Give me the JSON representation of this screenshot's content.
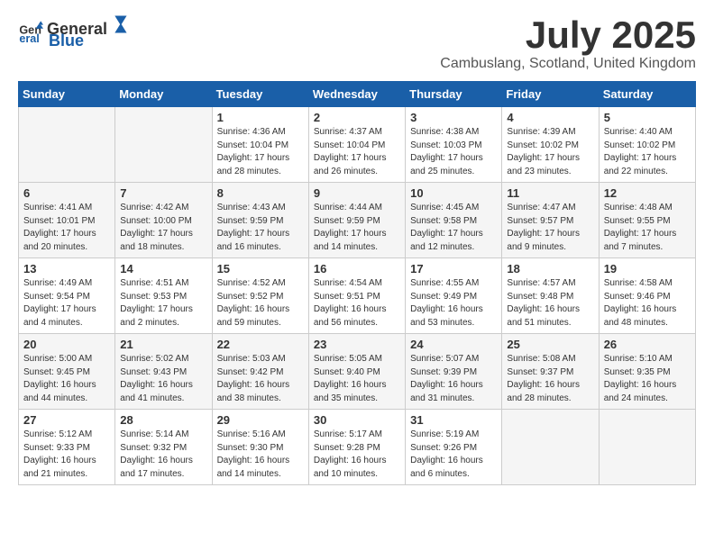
{
  "header": {
    "logo_general": "General",
    "logo_blue": "Blue",
    "month_title": "July 2025",
    "location": "Cambuslang, Scotland, United Kingdom"
  },
  "days_of_week": [
    "Sunday",
    "Monday",
    "Tuesday",
    "Wednesday",
    "Thursday",
    "Friday",
    "Saturday"
  ],
  "weeks": [
    [
      {
        "day": "",
        "info": ""
      },
      {
        "day": "",
        "info": ""
      },
      {
        "day": "1",
        "info": "Sunrise: 4:36 AM\nSunset: 10:04 PM\nDaylight: 17 hours and 28 minutes."
      },
      {
        "day": "2",
        "info": "Sunrise: 4:37 AM\nSunset: 10:04 PM\nDaylight: 17 hours and 26 minutes."
      },
      {
        "day": "3",
        "info": "Sunrise: 4:38 AM\nSunset: 10:03 PM\nDaylight: 17 hours and 25 minutes."
      },
      {
        "day": "4",
        "info": "Sunrise: 4:39 AM\nSunset: 10:02 PM\nDaylight: 17 hours and 23 minutes."
      },
      {
        "day": "5",
        "info": "Sunrise: 4:40 AM\nSunset: 10:02 PM\nDaylight: 17 hours and 22 minutes."
      }
    ],
    [
      {
        "day": "6",
        "info": "Sunrise: 4:41 AM\nSunset: 10:01 PM\nDaylight: 17 hours and 20 minutes."
      },
      {
        "day": "7",
        "info": "Sunrise: 4:42 AM\nSunset: 10:00 PM\nDaylight: 17 hours and 18 minutes."
      },
      {
        "day": "8",
        "info": "Sunrise: 4:43 AM\nSunset: 9:59 PM\nDaylight: 17 hours and 16 minutes."
      },
      {
        "day": "9",
        "info": "Sunrise: 4:44 AM\nSunset: 9:59 PM\nDaylight: 17 hours and 14 minutes."
      },
      {
        "day": "10",
        "info": "Sunrise: 4:45 AM\nSunset: 9:58 PM\nDaylight: 17 hours and 12 minutes."
      },
      {
        "day": "11",
        "info": "Sunrise: 4:47 AM\nSunset: 9:57 PM\nDaylight: 17 hours and 9 minutes."
      },
      {
        "day": "12",
        "info": "Sunrise: 4:48 AM\nSunset: 9:55 PM\nDaylight: 17 hours and 7 minutes."
      }
    ],
    [
      {
        "day": "13",
        "info": "Sunrise: 4:49 AM\nSunset: 9:54 PM\nDaylight: 17 hours and 4 minutes."
      },
      {
        "day": "14",
        "info": "Sunrise: 4:51 AM\nSunset: 9:53 PM\nDaylight: 17 hours and 2 minutes."
      },
      {
        "day": "15",
        "info": "Sunrise: 4:52 AM\nSunset: 9:52 PM\nDaylight: 16 hours and 59 minutes."
      },
      {
        "day": "16",
        "info": "Sunrise: 4:54 AM\nSunset: 9:51 PM\nDaylight: 16 hours and 56 minutes."
      },
      {
        "day": "17",
        "info": "Sunrise: 4:55 AM\nSunset: 9:49 PM\nDaylight: 16 hours and 53 minutes."
      },
      {
        "day": "18",
        "info": "Sunrise: 4:57 AM\nSunset: 9:48 PM\nDaylight: 16 hours and 51 minutes."
      },
      {
        "day": "19",
        "info": "Sunrise: 4:58 AM\nSunset: 9:46 PM\nDaylight: 16 hours and 48 minutes."
      }
    ],
    [
      {
        "day": "20",
        "info": "Sunrise: 5:00 AM\nSunset: 9:45 PM\nDaylight: 16 hours and 44 minutes."
      },
      {
        "day": "21",
        "info": "Sunrise: 5:02 AM\nSunset: 9:43 PM\nDaylight: 16 hours and 41 minutes."
      },
      {
        "day": "22",
        "info": "Sunrise: 5:03 AM\nSunset: 9:42 PM\nDaylight: 16 hours and 38 minutes."
      },
      {
        "day": "23",
        "info": "Sunrise: 5:05 AM\nSunset: 9:40 PM\nDaylight: 16 hours and 35 minutes."
      },
      {
        "day": "24",
        "info": "Sunrise: 5:07 AM\nSunset: 9:39 PM\nDaylight: 16 hours and 31 minutes."
      },
      {
        "day": "25",
        "info": "Sunrise: 5:08 AM\nSunset: 9:37 PM\nDaylight: 16 hours and 28 minutes."
      },
      {
        "day": "26",
        "info": "Sunrise: 5:10 AM\nSunset: 9:35 PM\nDaylight: 16 hours and 24 minutes."
      }
    ],
    [
      {
        "day": "27",
        "info": "Sunrise: 5:12 AM\nSunset: 9:33 PM\nDaylight: 16 hours and 21 minutes."
      },
      {
        "day": "28",
        "info": "Sunrise: 5:14 AM\nSunset: 9:32 PM\nDaylight: 16 hours and 17 minutes."
      },
      {
        "day": "29",
        "info": "Sunrise: 5:16 AM\nSunset: 9:30 PM\nDaylight: 16 hours and 14 minutes."
      },
      {
        "day": "30",
        "info": "Sunrise: 5:17 AM\nSunset: 9:28 PM\nDaylight: 16 hours and 10 minutes."
      },
      {
        "day": "31",
        "info": "Sunrise: 5:19 AM\nSunset: 9:26 PM\nDaylight: 16 hours and 6 minutes."
      },
      {
        "day": "",
        "info": ""
      },
      {
        "day": "",
        "info": ""
      }
    ]
  ]
}
